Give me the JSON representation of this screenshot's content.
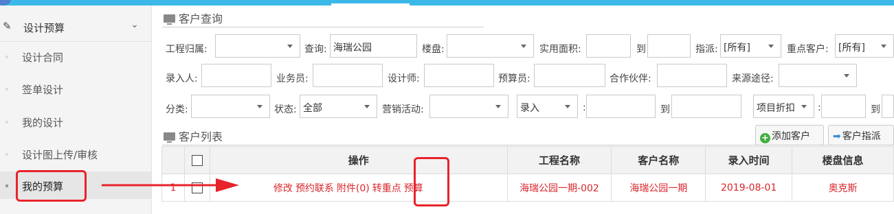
{
  "sidebar": {
    "header_label": "设计预算",
    "items": [
      {
        "label": "设计合同"
      },
      {
        "label": "签单设计"
      },
      {
        "label": "我的设计"
      },
      {
        "label": "设计图上传/审核"
      },
      {
        "label": "我的预算"
      }
    ],
    "active_item": "我的预算"
  },
  "query": {
    "title": "客户查询",
    "labels": {
      "project_owner": "工程归属:",
      "query": "查询:",
      "property": "楼盘:",
      "area": "实用面积:",
      "to": "到",
      "assign": "指派:",
      "key_customer": "重点客户:",
      "entered_by": "录入人:",
      "salesperson": "业务员:",
      "designer": "设计师:",
      "estimator": "预算员:",
      "partner": "合作伙伴:",
      "source": "来源途径:",
      "category": "分类:",
      "status": "状态:",
      "marketing": "营销活动:",
      "colon": ":",
      "to2": "到",
      "to3": "到"
    },
    "values": {
      "query": "海瑞公园",
      "assign": "[所有]",
      "key_customer": "[所有]",
      "status": "全部",
      "entry_select": "录入",
      "discount_select": "项目折扣"
    }
  },
  "list": {
    "title": "客户列表",
    "add_button": "添加客户",
    "assign_button": "客户指派",
    "columns": [
      "操作",
      "工程名称",
      "客户名称",
      "录入时间",
      "楼盘信息"
    ],
    "rows": [
      {
        "index": "1",
        "actions": [
          "修改",
          "预约联系",
          "附件(0)",
          "转重点",
          "预算"
        ],
        "project_name": "海瑞公园一期-002",
        "customer_name": "海瑞公园一期",
        "entry_time": "2019-08-01",
        "property_info": "奥克斯"
      }
    ]
  },
  "colors": {
    "accent_top": "#3bb8e8",
    "highlight": "#e8232a",
    "row_text": "#d9262b"
  }
}
